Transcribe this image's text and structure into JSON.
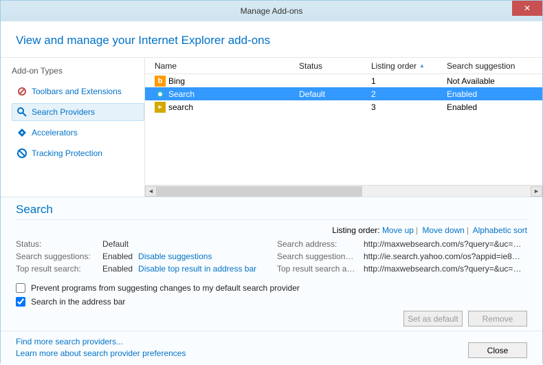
{
  "titlebar": {
    "title": "Manage Add-ons",
    "close": "✕"
  },
  "header": {
    "text": "View and manage your Internet Explorer add-ons"
  },
  "sidebar": {
    "title": "Add-on Types",
    "items": [
      {
        "label": "Toolbars and Extensions"
      },
      {
        "label": "Search Providers"
      },
      {
        "label": "Accelerators"
      },
      {
        "label": "Tracking Protection"
      }
    ]
  },
  "grid": {
    "headers": {
      "name": "Name",
      "status": "Status",
      "order": "Listing order",
      "sugg": "Search suggestion"
    },
    "rows": [
      {
        "name": "Bing",
        "status": "",
        "order": "1",
        "sugg": "Not Available",
        "icon_color": "#ff9a00"
      },
      {
        "name": "Search",
        "status": "Default",
        "order": "2",
        "sugg": "Enabled",
        "icon_color": "#2aa9e0"
      },
      {
        "name": "search",
        "status": "",
        "order": "3",
        "sugg": "Enabled",
        "icon_color": "#d4a800"
      }
    ]
  },
  "details": {
    "title": "Search",
    "listing_label": "Listing order:",
    "move_up": "Move up",
    "move_down": "Move down",
    "alpha_sort": "Alphabetic sort",
    "left": {
      "status_label": "Status:",
      "status_val": "Default",
      "sugg_label": "Search suggestions:",
      "sugg_val": "Enabled",
      "sugg_link": "Disable suggestions",
      "top_label": "Top result search:",
      "top_val": "Enabled",
      "top_link": "Disable top result in address bar"
    },
    "right": {
      "addr_label": "Search address:",
      "addr_val": "http://maxwebsearch.com/s?query=&uc=2015…",
      "sugg_label": "Search suggestion…",
      "sugg_val": "http://ie.search.yahoo.com/os?appid=ie8&co…",
      "top_label": "Top result search a…",
      "top_val": "http://maxwebsearch.com/s?query=&uc=2015…"
    },
    "chk_prevent": "Prevent programs from suggesting changes to my default search provider",
    "chk_addr": "Search in the address bar",
    "btn_default": "Set as default",
    "btn_remove": "Remove"
  },
  "footer": {
    "link1": "Find more search providers...",
    "link2": "Learn more about search provider preferences",
    "close": "Close"
  }
}
